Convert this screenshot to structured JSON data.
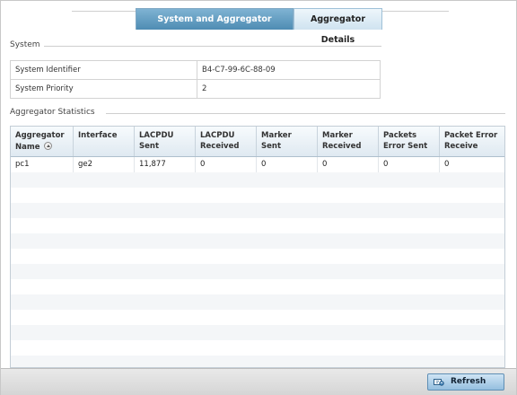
{
  "tabs": [
    {
      "label": "System and Aggregator Statistics"
    },
    {
      "label": "Aggregator Details"
    }
  ],
  "system": {
    "title": "System",
    "rows": [
      {
        "key": "System Identifier",
        "value": "B4-C7-99-6C-88-09"
      },
      {
        "key": "System Priority",
        "value": "2"
      }
    ]
  },
  "aggregator": {
    "title": "Aggregator Statistics",
    "columns": [
      "Aggregator Name",
      "Interface",
      "LACPDU Sent",
      "LACPDU Received",
      "Marker Sent",
      "Marker Received",
      "Packets Error Sent",
      "Packet Error Receive"
    ],
    "rows": [
      [
        "pc1",
        "ge2",
        "11,877",
        "0",
        "0",
        "0",
        "0",
        "0"
      ]
    ]
  },
  "footer": {
    "refresh_label": "Refresh"
  },
  "colors": {
    "active_tab": "#4e8cb3",
    "header_bg": "#dfe9f1",
    "button": "#95bfdf"
  }
}
